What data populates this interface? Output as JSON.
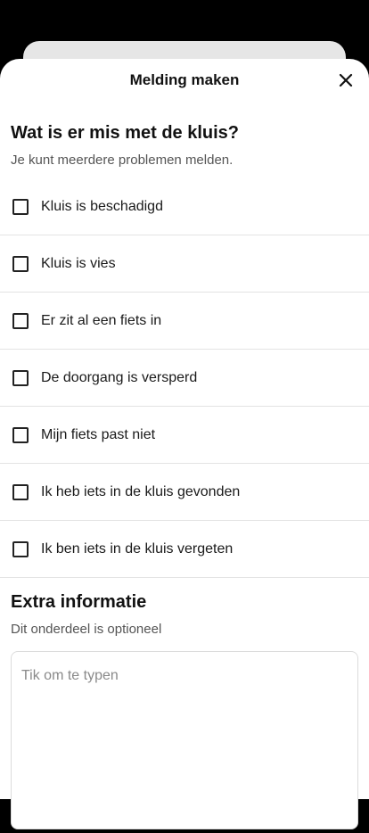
{
  "header": {
    "title": "Melding maken",
    "close_icon": "close-icon"
  },
  "problems": {
    "title": "Wat is er mis met de kluis?",
    "subtitle": "Je kunt meerdere problemen melden.",
    "options": [
      {
        "label": "Kluis is beschadigd",
        "checked": false
      },
      {
        "label": "Kluis is vies",
        "checked": false
      },
      {
        "label": "Er zit al een fiets in",
        "checked": false
      },
      {
        "label": "De doorgang is versperd",
        "checked": false
      },
      {
        "label": "Mijn fiets past niet",
        "checked": false
      },
      {
        "label": "Ik heb iets in de kluis gevonden",
        "checked": false
      },
      {
        "label": "Ik ben iets in de kluis vergeten",
        "checked": false
      }
    ]
  },
  "extra": {
    "title": "Extra informatie",
    "subtitle": "Dit onderdeel is optioneel",
    "placeholder": "Tik om te typen",
    "value": ""
  }
}
